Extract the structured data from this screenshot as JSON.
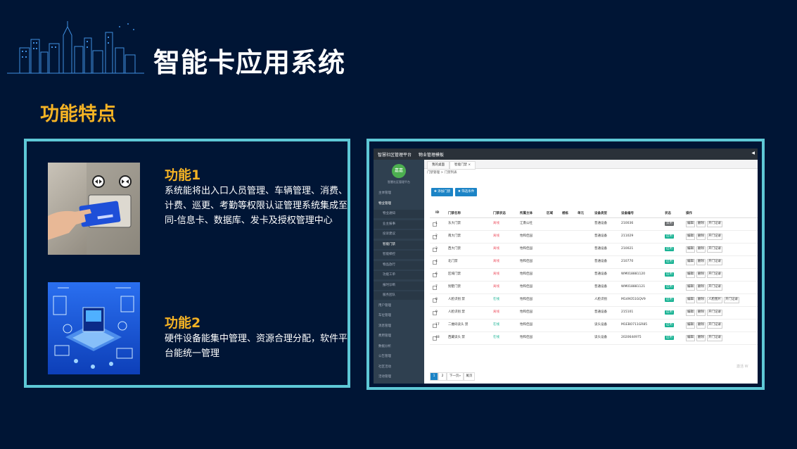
{
  "page": {
    "title": "智能卡应用系统",
    "subtitle": "功能特点"
  },
  "features": [
    {
      "title": "功能1",
      "desc": "系统能将出入口人员管理、车辆管理、消费、计费、巡更、考勤等权限认证管理系统集成至同-信息卡、数据库、发卡及授权管理中心"
    },
    {
      "title": "功能2",
      "desc": "硬件设备能集中管理、资源合理分配，软件平台能统一管理"
    }
  ],
  "screenshot": {
    "brand": "智慧社区管理平台",
    "module": "物业管理模板",
    "logo_text": "嘉嘉",
    "logo_sub": "智慧社区管理平台",
    "sidebar": [
      {
        "label": "主体管理",
        "sub": false
      },
      {
        "label": "物业管理",
        "sub": false,
        "active": true
      },
      {
        "label": "物业通知",
        "sub": true
      },
      {
        "label": "业主报事",
        "sub": true
      },
      {
        "label": "投诉建议",
        "sub": true
      },
      {
        "label": "智能门禁",
        "sub": true,
        "active": true
      },
      {
        "label": "智能梯控",
        "sub": true
      },
      {
        "label": "物品放行",
        "sub": true
      },
      {
        "label": "功能工单",
        "sub": true
      },
      {
        "label": "报时诊断",
        "sub": true
      },
      {
        "label": "服务团队",
        "sub": true
      },
      {
        "label": "用户管理",
        "sub": false
      },
      {
        "label": "车位管理",
        "sub": false
      },
      {
        "label": "消息管理",
        "sub": false
      },
      {
        "label": "费用管理",
        "sub": false
      },
      {
        "label": "数据分析",
        "sub": false
      },
      {
        "label": "公告管理",
        "sub": false
      },
      {
        "label": "社区活动",
        "sub": false
      },
      {
        "label": "活动管理",
        "sub": false
      },
      {
        "label": "系统管理",
        "sub": false
      }
    ],
    "tabs": [
      "我的桌面",
      "智能门禁 ×"
    ],
    "breadcrumb": "门禁管理 > 门禁列表",
    "buttons": {
      "add": "✚ 添加门禁",
      "filter": "✖ 筛选条件"
    },
    "columns": [
      "ID",
      "门禁名称",
      "门禁状态",
      "所属主体",
      "区域",
      "楼栋",
      "单元",
      "设备类型",
      "设备编号",
      "状态",
      "操作"
    ],
    "rows": [
      {
        "id": "1",
        "name": "东大门禁",
        "state": "离线",
        "owner": "江南公社",
        "type": "普通设备",
        "code": "210036",
        "status": "禁用",
        "status_color": "#676a6c",
        "actions": [
          "编辑",
          "删除",
          "开门记录"
        ]
      },
      {
        "id": "2",
        "name": "南大门禁",
        "state": "离线",
        "owner": "怡和佳园",
        "type": "普通设备",
        "code": "211029",
        "status": "启用",
        "status_color": "#1ab394",
        "actions": [
          "编辑",
          "删除",
          "开门记录"
        ]
      },
      {
        "id": "3",
        "name": "西大门禁",
        "state": "离线",
        "owner": "怡和佳园",
        "type": "普通设备",
        "code": "210021",
        "status": "启用",
        "status_color": "#1ab394",
        "actions": [
          "编辑",
          "删除",
          "开门记录"
        ]
      },
      {
        "id": "4",
        "name": "北门禁",
        "state": "离线",
        "owner": "怡和佳园",
        "type": "普通设备",
        "code": "210770",
        "status": "启用",
        "status_color": "#1ab394",
        "actions": [
          "编辑",
          "删除",
          "开门记录"
        ]
      },
      {
        "id": "6",
        "name": "区域门禁",
        "state": "离线",
        "owner": "怡和佳园",
        "type": "普通设备",
        "code": "WM018881120",
        "status": "启用",
        "status_color": "#1ab394",
        "actions": [
          "编辑",
          "删除",
          "开门记录"
        ]
      },
      {
        "id": "7",
        "name": "别墅门禁",
        "state": "离线",
        "owner": "怡和佳园",
        "type": "普通设备",
        "code": "WM018881121",
        "status": "启用",
        "status_color": "#1ab394",
        "actions": [
          "编辑",
          "删除",
          "开门记录"
        ]
      },
      {
        "id": "8",
        "name": "人脸识别 禁",
        "state": "在线",
        "owner": "怡和佳园",
        "type": "人脸识别",
        "code": "M149O51GQV9",
        "status": "启用",
        "status_color": "#1ab394",
        "actions": [
          "编辑",
          "删除",
          "人脸图片",
          "开门记录"
        ]
      },
      {
        "id": "9",
        "name": "人脸识别 禁",
        "state": "离线",
        "owner": "怡和佳园",
        "type": "普通设备",
        "code": "215101",
        "status": "启用",
        "status_color": "#1ab394",
        "actions": [
          "编辑",
          "删除",
          "开门记录"
        ]
      },
      {
        "id": "17",
        "name": "二维码读头 禁",
        "state": "在线",
        "owner": "怡和佳园",
        "type": "读头设备",
        "code": "M1EBO711GR85",
        "status": "启用",
        "status_color": "#1ab394",
        "actions": [
          "编辑",
          "删除",
          "开门记录"
        ]
      },
      {
        "id": "48",
        "name": "西藏读头 禁",
        "state": "在线",
        "owner": "怡和佳园",
        "type": "读头设备",
        "code": "2020644975",
        "status": "启用",
        "status_color": "#1ab394",
        "actions": [
          "编辑",
          "删除",
          "开门记录"
        ]
      }
    ],
    "pager": [
      "1",
      "2",
      "下一页»",
      "尾页"
    ],
    "watermark": "激活 W"
  },
  "colors": {
    "background": "#001535",
    "accent": "#f5b324",
    "border": "#5ec8d6"
  }
}
